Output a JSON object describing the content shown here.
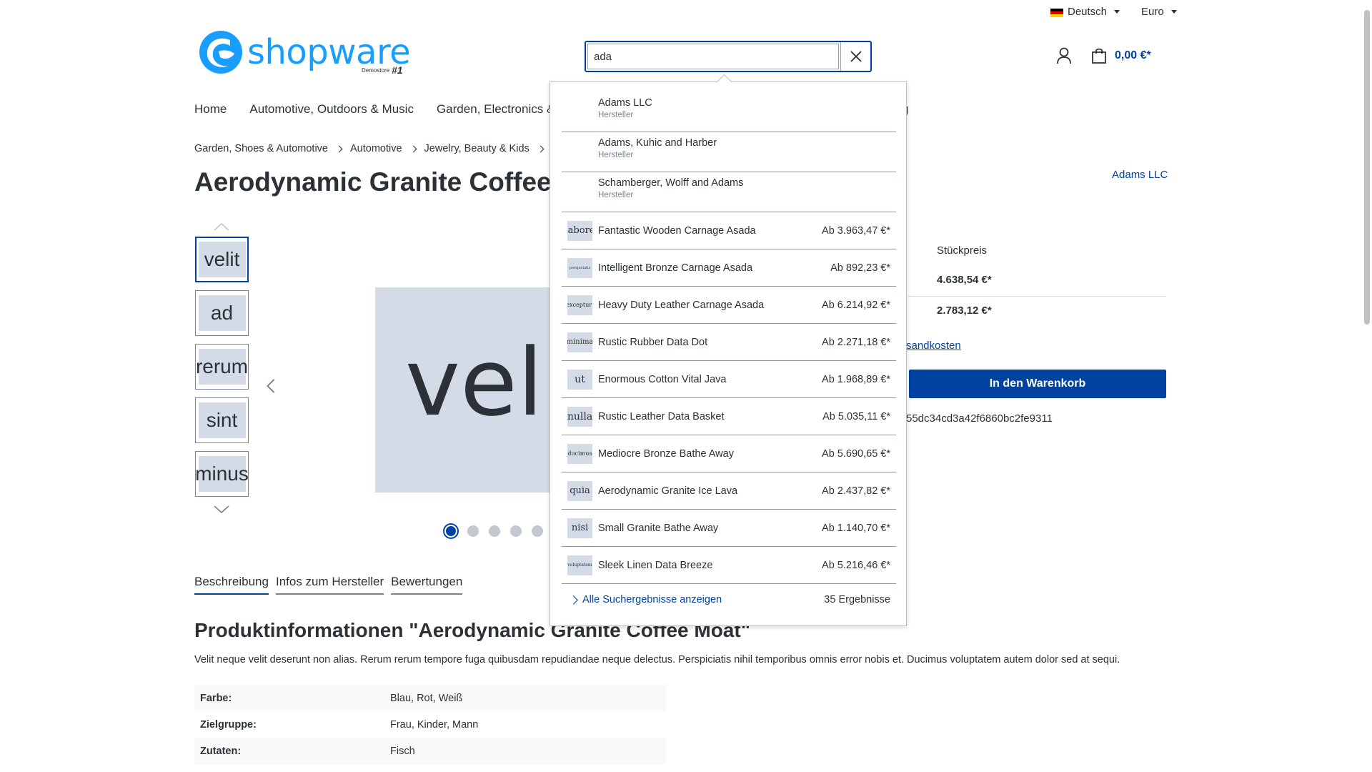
{
  "topbar": {
    "language": "Deutsch",
    "currency": "Euro"
  },
  "logo": {
    "wordmark": "shopware",
    "sub": "Demostore",
    "badge": "#1"
  },
  "search": {
    "value": "ada"
  },
  "cart": {
    "total": "0,00 €*"
  },
  "nav": {
    "items": [
      "Home",
      "Automotive, Outdoors & Music",
      "Garden, Electronics &"
    ],
    "extra": "g"
  },
  "breadcrumb": [
    "Garden, Shoes & Automotive",
    "Automotive",
    "Jewelry, Beauty & Kids"
  ],
  "product": {
    "title": "Aerodynamic Granite Coffee",
    "manufacturer": "Adams LLC",
    "unit_price_label": "Stückpreis",
    "price_1": "4.638,54 €*",
    "price_2": "2.783,12 €*",
    "shipping_link": "sandkosten",
    "buy_label": "In den Warenkorb",
    "product_number": "55dc34cd3a42f6860bc2fe9311",
    "main_image_text": "vel"
  },
  "thumbnails": [
    "velit",
    "ad",
    "rerum",
    "sint",
    "minus"
  ],
  "gallery": {
    "dot_count": 5,
    "active_dot": 0
  },
  "tabs": [
    "Beschreibung",
    "Infos zum Hersteller",
    "Bewertungen"
  ],
  "description": {
    "title": "Produktinformationen \"Aerodynamic Granite Coffee Moat\"",
    "text": "Velit neque velit deserunt non alias. Rerum rerum tempore fuga quibusdam repudiandae neque delectus. Perspiciatis nihil temporibus omnis error nobis et. Ducimus voluptatem autem dolor sed at sequi.",
    "properties": [
      {
        "key": "Farbe:",
        "value": "Blau, Rot, Weiß"
      },
      {
        "key": "Zielgruppe:",
        "value": "Frau, Kinder, Mann"
      },
      {
        "key": "Zutaten:",
        "value": "Fisch"
      }
    ]
  },
  "suggest": {
    "manufacturers": [
      {
        "name": "Adams LLC",
        "type": "Hersteller"
      },
      {
        "name": "Adams, Kuhic and Harber",
        "type": "Hersteller"
      },
      {
        "name": "Schamberger, Wolff and Adams",
        "type": "Hersteller"
      }
    ],
    "products": [
      {
        "thumb": "labore",
        "name": "Fantastic Wooden Carnage Asada",
        "price": "Ab 3.963,47 €*"
      },
      {
        "thumb": "perspiciatis",
        "name": "Intelligent Bronze Carnage Asada",
        "price": "Ab 892,23 €*"
      },
      {
        "thumb": "excepturi",
        "name": "Heavy Duty Leather Carnage Asada",
        "price": "Ab 6.214,92 €*"
      },
      {
        "thumb": "minima",
        "name": "Rustic Rubber Data Dot",
        "price": "Ab 2.271,18 €*"
      },
      {
        "thumb": "ut",
        "name": "Enormous Cotton Vital Java",
        "price": "Ab 1.968,89 €*"
      },
      {
        "thumb": "nulla",
        "name": "Rustic Leather Data Basket",
        "price": "Ab 5.035,11 €*"
      },
      {
        "thumb": "ducimus",
        "name": "Mediocre Bronze Bathe Away",
        "price": "Ab 5.690,65 €*"
      },
      {
        "thumb": "quia",
        "name": "Aerodynamic Granite Ice Lava",
        "price": "Ab 2.437,82 €*"
      },
      {
        "thumb": "nisi",
        "name": "Small Granite Bathe Away",
        "price": "Ab 1.140,70 €*"
      },
      {
        "thumb": "voluptatem",
        "name": "Sleek Linen Data Breeze",
        "price": "Ab 5.216,46 €*"
      }
    ],
    "show_all": "Alle Suchergebnisse anzeigen",
    "result_count": "35 Ergebnisse"
  },
  "icons": {
    "flag": "german-flag-icon",
    "account": "user-icon",
    "cart": "bag-icon",
    "clear": "close-icon"
  },
  "colors": {
    "primary": "#0042a0",
    "brand": "#189eff"
  }
}
